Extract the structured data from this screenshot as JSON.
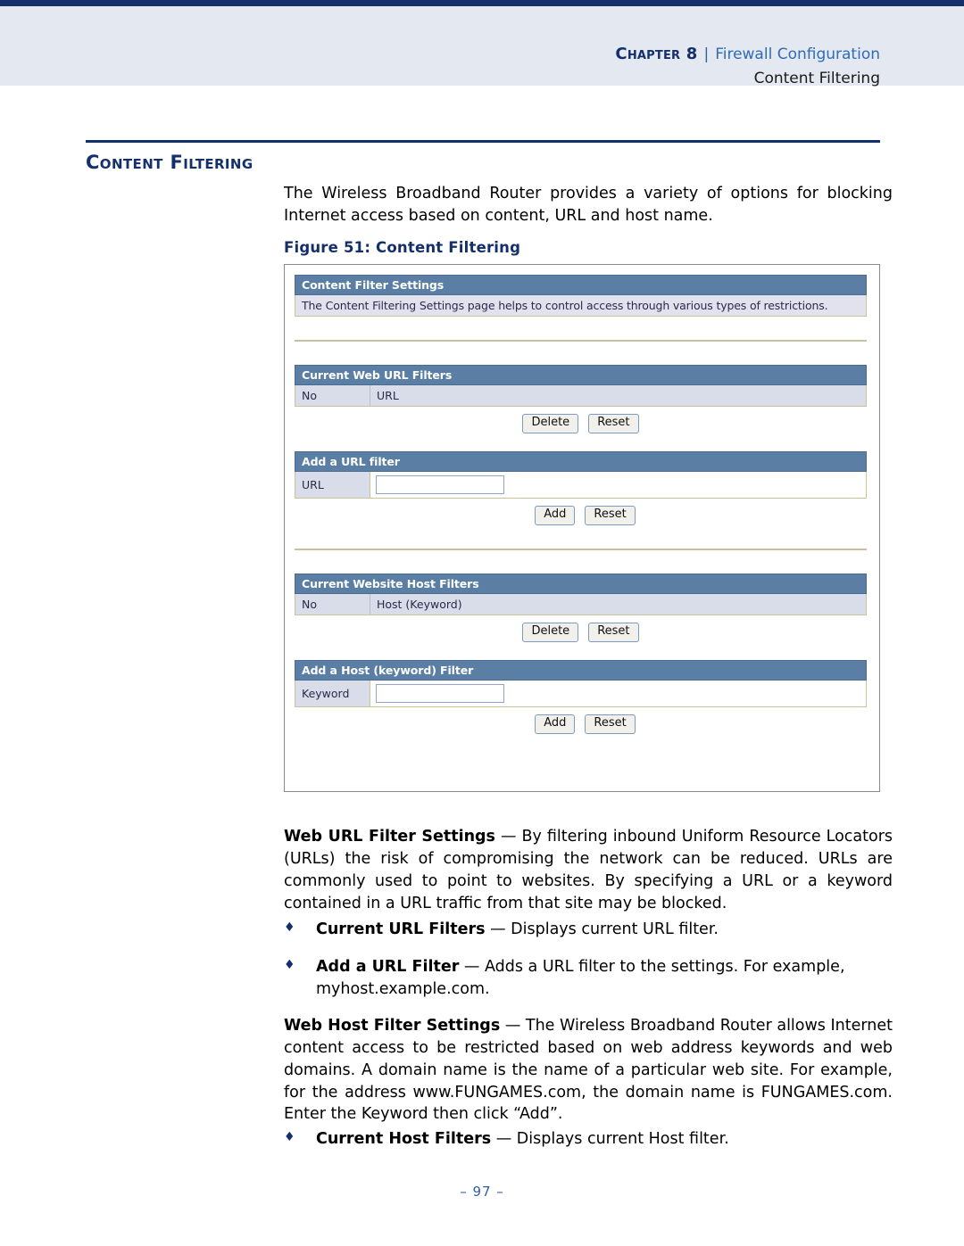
{
  "header": {
    "chapter_label": "Chapter 8",
    "separator": "|",
    "chapter_title": "Firewall Configuration",
    "subtitle": "Content Filtering"
  },
  "section": {
    "title": "Content Filtering",
    "intro": "The Wireless Broadband Router provides a variety of options for blocking Internet access based on content, URL and host name."
  },
  "figure": {
    "caption": "Figure 51:  Content Filtering",
    "panels": {
      "content_filter_settings": {
        "bar_title": "Content Filter Settings",
        "description": "The Content Filtering Settings page helps to control access through various types of restrictions."
      },
      "current_web_url_filters": {
        "bar_title": "Current Web URL Filters",
        "col_no": "No",
        "col_url": "URL",
        "delete_label": "Delete",
        "reset_label": "Reset"
      },
      "add_a_url_filter": {
        "bar_title": "Add a URL filter",
        "field_label": "URL",
        "field_value": "",
        "add_label": "Add",
        "reset_label": "Reset"
      },
      "current_website_host_filters": {
        "bar_title": "Current Website Host Filters",
        "col_no": "No",
        "col_host": "Host (Keyword)",
        "delete_label": "Delete",
        "reset_label": "Reset"
      },
      "add_a_host_filter": {
        "bar_title": "Add a Host (keyword) Filter",
        "field_label": "Keyword",
        "field_value": "",
        "add_label": "Add",
        "reset_label": "Reset"
      }
    }
  },
  "body": {
    "web_url_filter_settings": {
      "term": "Web URL Filter Settings",
      "dash": " — ",
      "text": "By filtering inbound Uniform Resource Locators (URLs) the risk of compromising the network can be reduced. URLs are commonly used to point to websites. By specifying a URL or a keyword contained in a URL traffic from that site may be blocked."
    },
    "bullets_url": [
      {
        "marker": "♦",
        "term": "Current URL Filters",
        "dash": " — ",
        "text": "Displays current URL filter."
      },
      {
        "marker": "♦",
        "term": "Add a URL Filter",
        "dash": " — ",
        "text": "Adds a URL filter to the settings. For example, myhost.example.com."
      }
    ],
    "web_host_filter_settings": {
      "term": "Web Host Filter Settings",
      "dash": " — ",
      "text": "The Wireless Broadband Router allows Internet content access to be restricted based on web address keywords and web domains. A domain name is the name of a particular web site. For example, for the address www.FUNGAMES.com, the domain name is FUNGAMES.com. Enter the Keyword then click “Add”."
    },
    "bullets_host": [
      {
        "marker": "♦",
        "term": "Current Host Filters",
        "dash": " — ",
        "text": "Displays current Host filter."
      }
    ]
  },
  "footer": {
    "page_number": "–  97  –"
  },
  "colors": {
    "navy": "#14306b",
    "link_blue": "#2f6cb5",
    "header_band": "#e4e8f0",
    "ui_bar": "#5a7ea4",
    "ui_row": "#d9dde9",
    "ui_desc": "#e2e2ee",
    "divider_tan": "#c6c2a0"
  }
}
